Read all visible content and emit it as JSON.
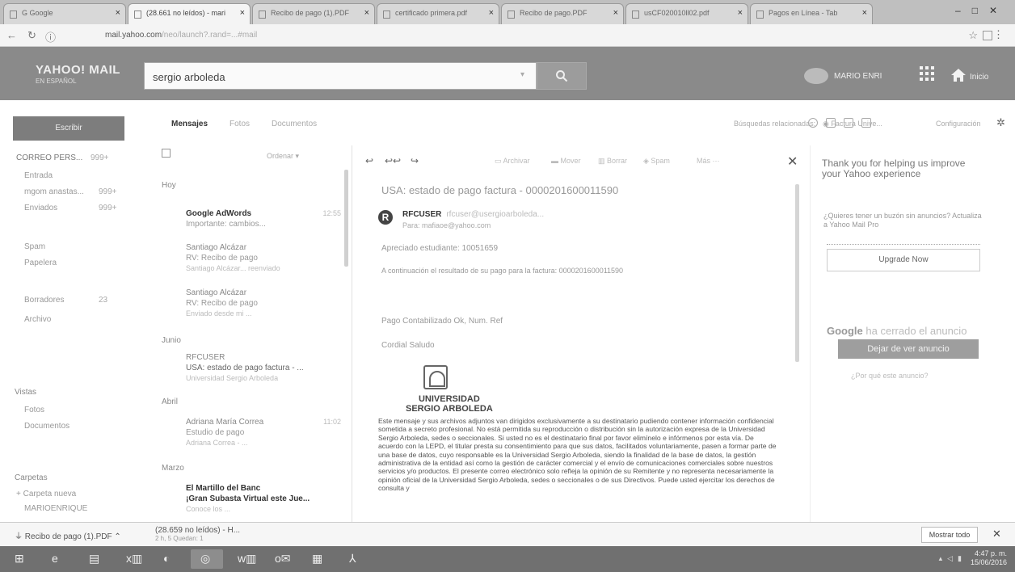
{
  "browser": {
    "tabs": [
      {
        "label": "G Google"
      },
      {
        "label": "(28.661 no leídos) - mari"
      },
      {
        "label": "Recibo de pago (1).PDF"
      },
      {
        "label": "certificado primera.pdf"
      },
      {
        "label": "Recibo de pago.PDF"
      },
      {
        "label": "usCF020010ll02.pdf"
      },
      {
        "label": "Pagos en Línea - Tab"
      }
    ],
    "url_host": "mail.yahoo.com",
    "url_rest": "/neo/launch?.rand=...#mail"
  },
  "header": {
    "logo": "YAHOO! MAIL",
    "logo_sub": "EN ESPAÑOL",
    "search_value": "sergio arboleda",
    "user": "MARIO ENRI",
    "home_label": "Inicio"
  },
  "sidebar": {
    "compose": "Escribir",
    "account": "CORREO PERS...",
    "account_count": "999+",
    "folders": [
      {
        "label": "Entrada",
        "count": ""
      },
      {
        "label": "mgom anastas...",
        "count": "999+"
      },
      {
        "label": "Enviados",
        "count": "999+"
      },
      {
        "label": "Spam",
        "count": ""
      },
      {
        "label": "Papelera",
        "count": ""
      },
      {
        "label": "Borradores",
        "count": "23"
      },
      {
        "label": "Archivo",
        "count": ""
      }
    ],
    "views_head": "Vistas",
    "views": [
      {
        "label": "Fotos"
      },
      {
        "label": "Documentos"
      }
    ],
    "folders_head": "Carpetas",
    "new_folder": "+ Carpeta nueva",
    "last_folder": "MARIOENRIQUE"
  },
  "subtabs": {
    "messages": "Mensajes",
    "photos": "Fotos",
    "documents": "Documentos",
    "related": "Búsquedas relacionadas:",
    "related_term": "Factura Unive...",
    "settings": "Configuración"
  },
  "msglist": {
    "sort": "Ordenar",
    "groups": [
      "Hoy",
      "Junio",
      "Abril",
      "Marzo"
    ],
    "messages": [
      {
        "from": "Google AdWords",
        "l2": "Importante: cambios...",
        "l3": "",
        "date": "12:55"
      },
      {
        "from": "Santiago Alcázar",
        "l2": "RV: Recibo de pago",
        "l3": "Santiago Alcázar... reenviado",
        "date": ""
      },
      {
        "from": "Santiago Alcázar",
        "l2": "RV: Recibo de pago",
        "l3": "Enviado desde mi ...",
        "date": ""
      },
      {
        "from": "RFCUSER",
        "l2": "USA: estado de pago factura - ...",
        "l3": "Universidad Sergio Arboleda",
        "date": ""
      },
      {
        "from": "Adriana María Correa",
        "l2": "Estudio de pago",
        "l3": "Adriana Correa - ...",
        "date": "11:02"
      },
      {
        "from": "El Martillo del Banc",
        "l2": "¡Gran Subasta Virtual este Jue...",
        "l3": "Conoce los ...",
        "date": ""
      }
    ]
  },
  "reading": {
    "toolbar": [
      "Archivar",
      "Mover",
      "Borrar",
      "Spam",
      "Más"
    ],
    "subject": "USA: estado de pago factura - 0000201600011590",
    "sender": "RFCUSER",
    "sender_faint": "rfcuser@usergioarboleda...",
    "recipient": "Para: mafiaoe@yahoo.com",
    "l1": "Apreciado estudiante: 10051659",
    "l2": "A continuación el resultado de su pago para la factura: 0000201600011590",
    "l3": "Pago Contabilizado Ok, Num. Ref",
    "l4": "Cordial Saludo",
    "univ_line1": "UNIVERSIDAD",
    "univ_line2": "SERGIO ARBOLEDA",
    "disclaimer": "Este mensaje y sus archivos adjuntos van dirigidos exclusivamente a su destinatario pudiendo contener información confidencial sometida a secreto profesional. No está permitida su reproducción o distribución sin la autorización expresa de la Universidad Sergio Arboleda, sedes o seccionales. Si usted no es el destinatario final por favor elimínelo e infórmenos por esta vía. De acuerdo con la LEPD, el titular presta su consentimiento para que sus datos, facilitados voluntariamente, pasen a formar parte de una base de datos, cuyo responsable es la Universidad Sergio Arboleda, siendo la finalidad de la base de datos, la gestión administrativa de la entidad así como la gestión de carácter comercial y el envío de comunicaciones comerciales sobre nuestros servicios y/o productos. El presente correo electrónico solo refleja la opinión de su Remitente y no representa necesariamente la opinión oficial de la Universidad Sergio Arboleda, sedes o seccionales o de sus Directivos. Puede usted ejercitar los derechos de consulta y"
  },
  "ad": {
    "thanks": "Thank you for helping us improve your Yahoo experience",
    "text": "¿Quieres tener un buzón sin anuncios? Actualiza a Yahoo Mail Pro",
    "upgrade": "Upgrade Now",
    "google_g": "Google",
    "google_rest": " ha cerrado el anuncio",
    "stop": "Dejar de ver anuncio",
    "why": "¿Por qué este anuncio?"
  },
  "downloads": {
    "item1": "Recibo de pago (1).PDF",
    "item2": "(28.659 no leídos) - H...",
    "item2_sub": "2 h, 5 Quedan: 1",
    "show_all": "Mostrar todo"
  },
  "taskbar": {
    "time": "4:47 p. m.",
    "date": "15/06/2016"
  },
  "colors": {
    "header_bg": "#8a8a8a",
    "taskbar_bg": "#707070"
  }
}
